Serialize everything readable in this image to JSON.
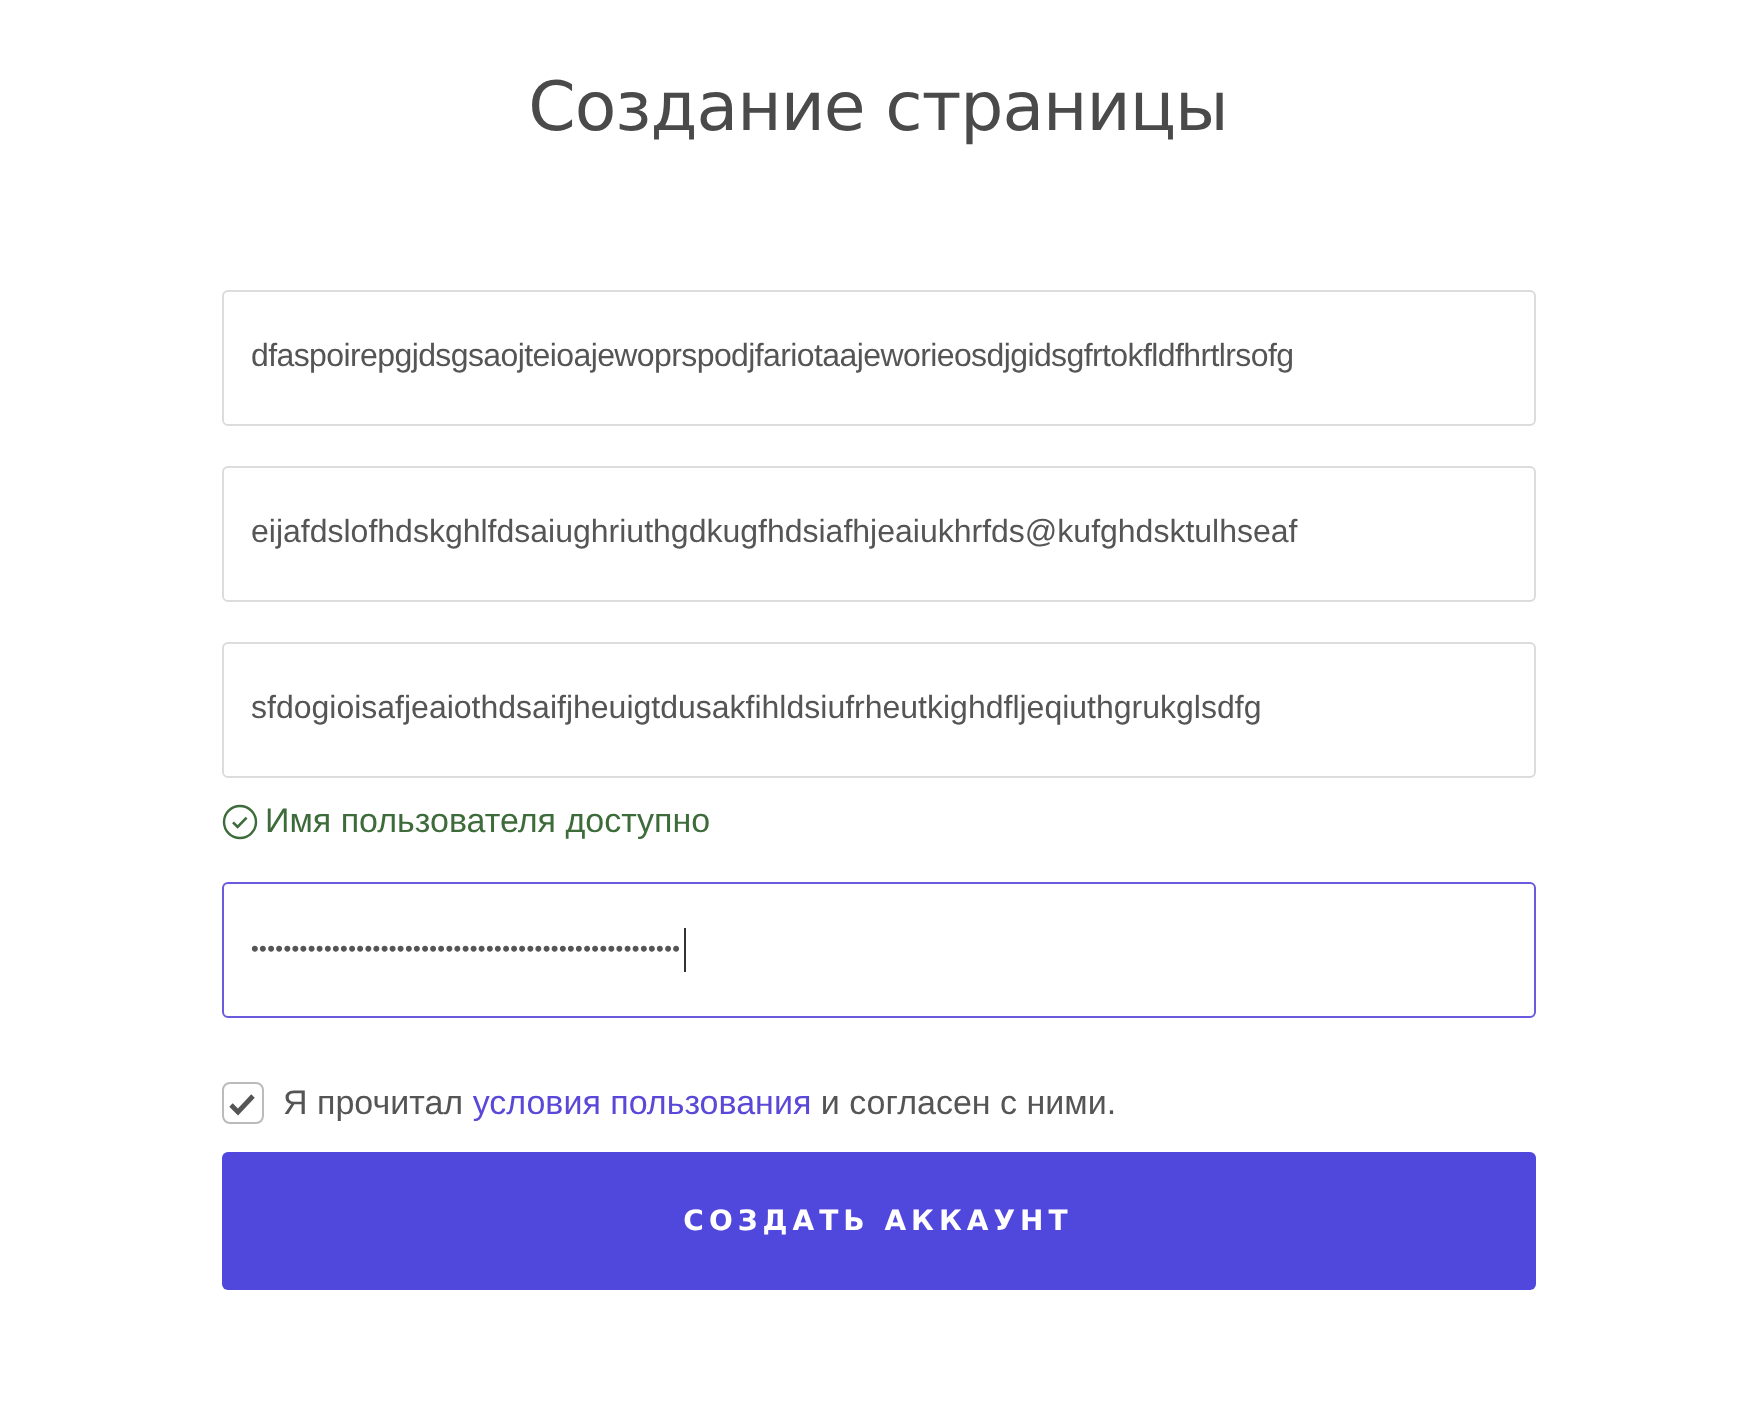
{
  "title": "Создание страницы",
  "fields": [
    {
      "value": "dfaspoirepgjdsgsaojteioajewoprspodjfariotaajeworieosdjgidsgfrtokfldfhrtlrsofg",
      "focused": false
    },
    {
      "value": "eijafdslofhdskghlfdsaiughriuthgdkugfhdsiafhjeaiukhrfds@kufghdsktulhseaf",
      "focused": false
    },
    {
      "value": "sfdogioisafjeaiothdsaifjheuigtdusakfihldsiufrheutkighdfljeqiuthgrukglsdfg",
      "focused": false
    }
  ],
  "availability": {
    "text": "Имя пользователя доступно",
    "ok": true
  },
  "password": {
    "value": "•••••••••••••••••••••••••••••••••••••••••••••••••••••",
    "focused": true
  },
  "agreement": {
    "checked": true,
    "before": "Я прочитал",
    "link": "условия пользования",
    "after": "и согласен с ними."
  },
  "submit": "СОЗДАТЬ АККАУНТ"
}
